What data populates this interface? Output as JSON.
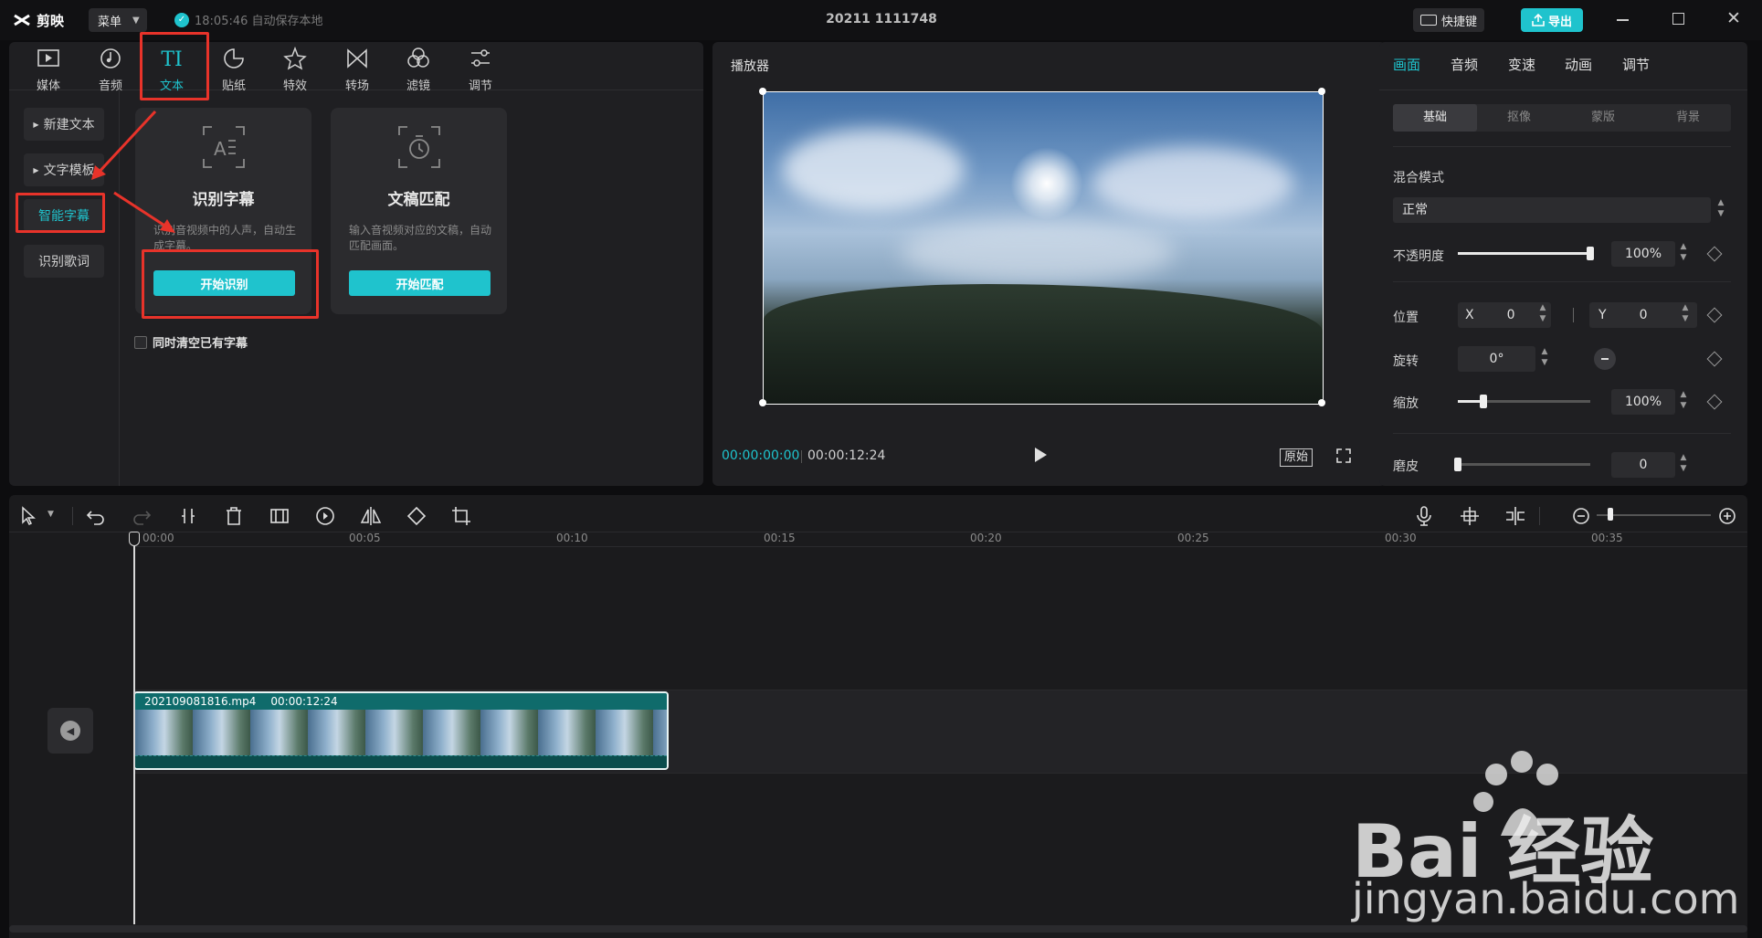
{
  "app": {
    "name": "剪映",
    "menu_label": "菜单",
    "autosave_text": "18:05:46 自动保存本地",
    "project_title": "20211 1111748",
    "shortcut_label": "快捷键",
    "export_label": "导出"
  },
  "toolbar": {
    "tabs": [
      {
        "label": "媒体",
        "icon": "media-icon"
      },
      {
        "label": "音频",
        "icon": "audio-icon"
      },
      {
        "label": "文本",
        "icon": "text-icon",
        "active": true
      },
      {
        "label": "贴纸",
        "icon": "sticker-icon"
      },
      {
        "label": "特效",
        "icon": "effects-icon"
      },
      {
        "label": "转场",
        "icon": "transition-icon"
      },
      {
        "label": "滤镜",
        "icon": "filter-icon"
      },
      {
        "label": "调节",
        "icon": "adjust-icon"
      }
    ]
  },
  "text_sidebar": {
    "items": [
      {
        "label": "新建文本"
      },
      {
        "label": "文字模板"
      },
      {
        "label": "智能字幕",
        "active": true
      },
      {
        "label": "识别歌词"
      }
    ]
  },
  "cards": [
    {
      "title": "识别字幕",
      "desc": "识别音视频中的人声，自动生成字幕。",
      "button": "开始识别"
    },
    {
      "title": "文稿匹配",
      "desc": "输入音视频对应的文稿，自动匹配画面。",
      "button": "开始匹配"
    }
  ],
  "clear_checkbox_label": "同时清空已有字幕",
  "player": {
    "title": "播放器",
    "current_time": "00:00:00:00",
    "total_time": "00:00:12:24",
    "ratio_label": "原始"
  },
  "properties": {
    "tabs": [
      "画面",
      "音频",
      "变速",
      "动画",
      "调节"
    ],
    "active_tab": "画面",
    "subtabs": [
      "基础",
      "抠像",
      "蒙版",
      "背景"
    ],
    "active_subtab": "基础",
    "blend_mode_label": "混合模式",
    "blend_mode_value": "正常",
    "opacity_label": "不透明度",
    "opacity_value": "100%",
    "opacity_level": 1.0,
    "position_label": "位置",
    "x_label": "X",
    "x_value": "0",
    "y_label": "Y",
    "y_value": "0",
    "rotation_label": "旋转",
    "rotation_value": "0°",
    "scale_label": "缩放",
    "scale_value": "100%",
    "smooth_label": "磨皮",
    "smooth_value": "0"
  },
  "timeline": {
    "ticks": [
      "00:00",
      "00:05",
      "00:10",
      "00:15",
      "00:20",
      "00:25",
      "00:30",
      "00:35"
    ],
    "clip_name": "202109081816.mp4",
    "clip_duration": "00:00:12:24"
  },
  "watermark": {
    "logo_text": "Bai 经验",
    "url": "jingyan.baidu.com"
  },
  "colors": {
    "accent": "#1fc3cd",
    "annotation_red": "#e8332a",
    "export_button": "#1fc3cd"
  }
}
